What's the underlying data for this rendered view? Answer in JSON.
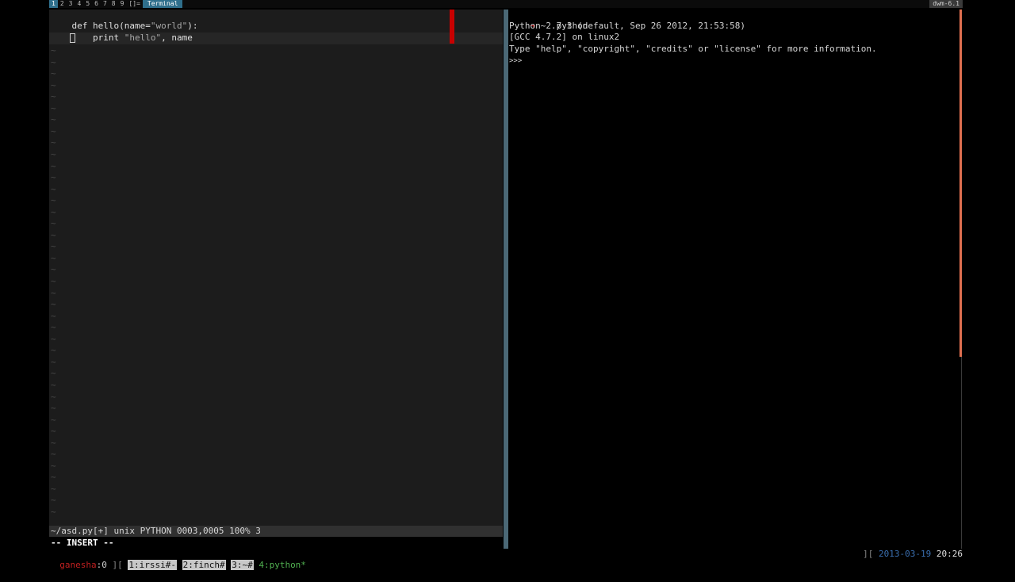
{
  "topbar": {
    "tags": [
      "1",
      "2",
      "3",
      "4",
      "5",
      "6",
      "7",
      "8",
      "9"
    ],
    "selected_tag": "1",
    "layout_symbol": "[]=",
    "window_title": "Terminal",
    "dwm_version": "dwm-6.1"
  },
  "vim": {
    "lines": [
      {
        "pre": "def hello(name=",
        "str": "\"world\"",
        "post": "):"
      },
      {
        "pre": "    print ",
        "str": "\"hello\"",
        "post": ", name"
      }
    ],
    "tilde": "~",
    "statusline": "~/asd.py[+] unix PYTHON 0003,0005 100% 3",
    "mode": "-- INSERT --"
  },
  "python": {
    "prompt_arrow": "➜",
    "prompt_dir": "~",
    "command": "python",
    "output": [
      "Python 2.7.3 (default, Sep 26 2012, 21:53:58)",
      "[GCC 4.7.2] on linux2",
      "Type \"help\", \"copyright\", \"credits\" or \"license\" for more information.",
      ">>>"
    ]
  },
  "tmux": {
    "session": "ganesha",
    "session_index": ":0",
    "sep_open": " ][ ",
    "windows": [
      {
        "label": "1:irssi#-",
        "active": false
      },
      {
        "label": "2:finch#",
        "active": false
      },
      {
        "label": "3:~#",
        "active": false
      },
      {
        "label": "4:python*",
        "active": true
      }
    ],
    "sep_right": "][ ",
    "date": "2013-03-19",
    "time": "20:26"
  },
  "colors": {
    "accent": "#2f6f8c",
    "vim_bg": "#1c1c1c",
    "colorcolumn": "#c80000",
    "session": "#c02020",
    "active_window": "#50b050",
    "date": "#3a6fb0"
  }
}
